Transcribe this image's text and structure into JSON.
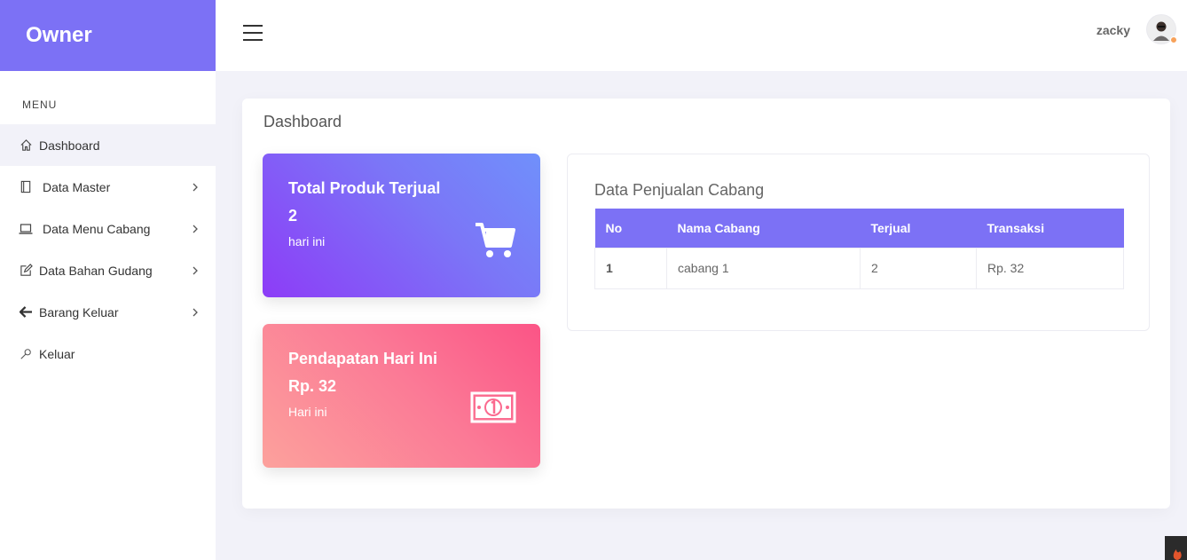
{
  "sidebar": {
    "brand": "Owner",
    "menu_title": "MENU",
    "items": [
      {
        "label": "Dashboard",
        "icon": "home-icon"
      },
      {
        "label": "Data Master",
        "icon": "book-icon"
      },
      {
        "label": "Data Menu Cabang",
        "icon": "laptop-icon"
      },
      {
        "label": "Data Bahan Gudang",
        "icon": "edit-icon"
      },
      {
        "label": "Barang Keluar",
        "icon": "arrow-left-icon"
      },
      {
        "label": "Keluar",
        "icon": "key-icon"
      }
    ]
  },
  "topbar": {
    "username": "zacky"
  },
  "main": {
    "page_title": "Dashboard",
    "stats": [
      {
        "title": "Total Produk Terjual",
        "value": "2",
        "subtitle": "hari ini",
        "icon": "cart-icon"
      },
      {
        "title": "Pendapatan Hari Ini",
        "value": "Rp. 32",
        "subtitle": "Hari ini",
        "icon": "money-icon"
      }
    ],
    "table": {
      "title": "Data Penjualan Cabang",
      "headers": [
        "No",
        "Nama Cabang",
        "Terjual",
        "Transaksi"
      ],
      "rows": [
        [
          "1",
          "cabang 1",
          "2",
          "Rp. 32"
        ]
      ]
    }
  },
  "colors": {
    "accent": "#7c71f5",
    "stat1_gradient": [
      "#8d3cf7",
      "#7090fb"
    ],
    "stat2_gradient": [
      "#fca19c",
      "#fb5486"
    ]
  }
}
